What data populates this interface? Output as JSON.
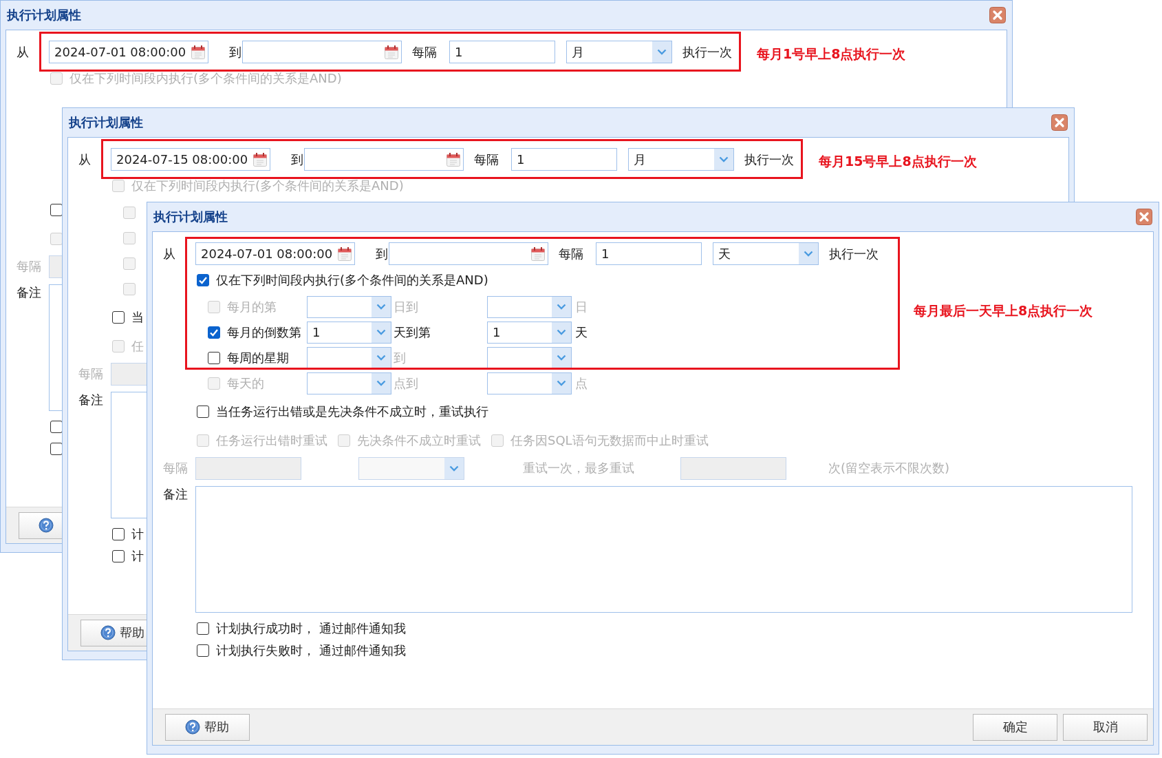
{
  "windows": [
    {
      "title": "执行计划属性",
      "highlight": {
        "kind": "schedule_row"
      },
      "annotation": "每月1号早上8点执行一次",
      "schedule": {
        "from_label": "从",
        "start_value": "2024-07-01 08:00:00",
        "to_label": "到",
        "every_label": "每隔",
        "interval_value": "1",
        "unit_value": "月",
        "suffix": "执行一次"
      },
      "time_window": {
        "label": "仅在下列时间段内执行(多个条件间的关系是AND)",
        "checked": false,
        "disabled": true
      },
      "retry": {
        "checked": false,
        "disabled": false
      },
      "retry_options": [
        {
          "checked": false,
          "disabled": true
        }
      ],
      "retry_every": {
        "kind": "label_and_field",
        "label": "每隔",
        "disabled": true
      },
      "remark": {
        "label": "备注"
      },
      "notify": [
        {
          "checked": false
        },
        {
          "checked": false
        }
      ],
      "help_button": {
        "kind": "icon_only"
      }
    },
    {
      "title": "执行计划属性",
      "highlight": {
        "kind": "schedule_row"
      },
      "annotation": "每月15号早上8点执行一次",
      "schedule": {
        "from_label": "从",
        "start_value": "2024-07-15 08:00:00",
        "to_label": "到",
        "every_label": "每隔",
        "interval_value": "1",
        "unit_value": "月",
        "suffix": "执行一次"
      },
      "time_window": {
        "label": "仅在下列时间段内执行(多个条件间的关系是AND)",
        "checked": false,
        "disabled": true
      },
      "conditions": [
        {
          "kind": "checkbox_only",
          "checked": false,
          "disabled": true
        },
        {
          "kind": "checkbox_only",
          "checked": false,
          "disabled": true
        },
        {
          "kind": "checkbox_only",
          "checked": false,
          "disabled": true
        },
        {
          "kind": "checkbox_only",
          "checked": false,
          "disabled": true
        }
      ],
      "retry": {
        "checked": false,
        "disabled": false,
        "label": "当"
      },
      "retry_options": [
        {
          "checked": false,
          "disabled": true,
          "label": "任"
        }
      ],
      "retry_every": {
        "kind": "label_and_field",
        "label": "每隔",
        "disabled": true
      },
      "remark": {
        "label": "备注"
      },
      "notify": [
        {
          "checked": false,
          "label": "计"
        },
        {
          "checked": false,
          "label": "计"
        }
      ],
      "help_button": {
        "kind": "icon_and_label",
        "label": "帮助"
      }
    },
    {
      "title": "执行计划属性",
      "highlight": {
        "kind": "schedule_and_conditions"
      },
      "annotation": "每月最后一天早上8点执行一次",
      "schedule": {
        "from_label": "从",
        "start_value": "2024-07-01 08:00:00",
        "to_label": "到",
        "every_label": "每隔",
        "interval_value": "1",
        "unit_value": "天",
        "suffix": "执行一次"
      },
      "time_window": {
        "label": "仅在下列时间段内执行(多个条件间的关系是AND)",
        "checked": true,
        "disabled": false
      },
      "conditions": [
        {
          "kind": "full",
          "checked": false,
          "disabled": true,
          "label": "每月的第",
          "middle_label": "日到",
          "end_label": "日"
        },
        {
          "kind": "full",
          "checked": true,
          "disabled": false,
          "label": "每月的倒数第",
          "first_value": "1",
          "middle_label": "天到第",
          "second_value": "1",
          "end_label": "天"
        },
        {
          "kind": "full",
          "checked": false,
          "disabled": false,
          "label": "每周的星期",
          "middle_label": "到"
        },
        {
          "kind": "full",
          "checked": false,
          "disabled": true,
          "label": "每天的",
          "middle_label": "点到",
          "end_label": "点"
        }
      ],
      "retry": {
        "checked": false,
        "disabled": false,
        "label": "当任务运行出错或是先决条件不成立时，重试执行"
      },
      "retry_options": [
        {
          "checked": false,
          "disabled": true,
          "label": "任务运行出错时重试"
        },
        {
          "checked": false,
          "disabled": true,
          "label": "先决条件不成立时重试"
        },
        {
          "checked": false,
          "disabled": true,
          "label": "任务因SQL语句无数据而中止时重试"
        }
      ],
      "retry_every": {
        "kind": "full",
        "label": "每隔",
        "disabled": true,
        "middle_label": "重试一次，最多重试",
        "end_label": "次(留空表示不限次数)"
      },
      "remark": {
        "label": "备注"
      },
      "notify": [
        {
          "checked": false,
          "label": "计划执行成功时， 通过邮件通知我"
        },
        {
          "checked": false,
          "label": "计划执行失败时， 通过邮件通知我"
        }
      ],
      "help_button": {
        "kind": "icon_and_label",
        "label": "帮助"
      },
      "buttons": [
        {
          "label": "确定"
        },
        {
          "label": "取消"
        }
      ]
    }
  ]
}
